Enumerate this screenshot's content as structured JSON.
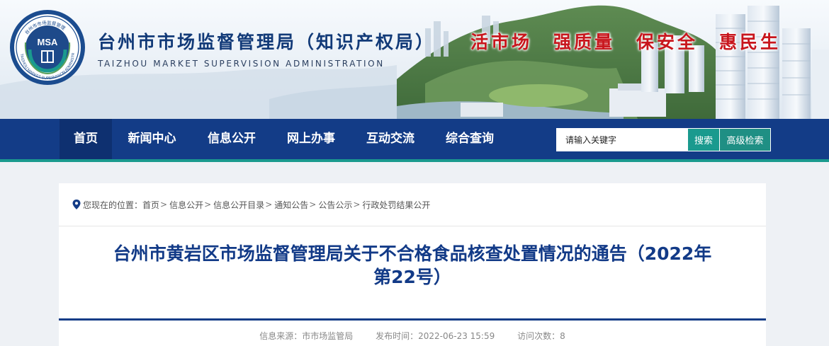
{
  "header": {
    "site_title": "台州市市场监督管理局（知识产权局）",
    "site_subtitle": "TAIZHOU MARKET SUPERVISION ADMINISTRATION",
    "logo_text": "MSA",
    "logo_ring_text": "TAIZHOU MARKET SUPERVISION ADMINISTRATION",
    "logo_top_text": "台州市市场监督管理",
    "slogans": [
      "活市场",
      "强质量",
      "保安全",
      "惠民生"
    ]
  },
  "nav": {
    "items": [
      {
        "label": "首页",
        "active": true
      },
      {
        "label": "新闻中心"
      },
      {
        "label": "信息公开"
      },
      {
        "label": "网上办事"
      },
      {
        "label": "互动交流"
      },
      {
        "label": "综合查询"
      }
    ],
    "search_placeholder": "请输入关键字",
    "search_button": "搜索",
    "advanced_button": "高级检索"
  },
  "breadcrumb": {
    "prefix": "您现在的位置：",
    "items": [
      "首页",
      "信息公开",
      "信息公开目录",
      "通知公告",
      "公告公示",
      "行政处罚结果公开"
    ]
  },
  "article": {
    "title_line1": "台州市黄岩区市场监督管理局关于不合格食品核查处置情况的通告（2022年",
    "title_line2": "第22号）",
    "source": "信息来源：市市场监管局",
    "date": "发布时间：2022-06-23 15:59",
    "views": "访问次数：8"
  },
  "colors": {
    "nav_bg": "#133c87",
    "accent_teal": "#1a9a8e",
    "title_blue": "#123a87",
    "slogan_red": "#c8161d"
  }
}
